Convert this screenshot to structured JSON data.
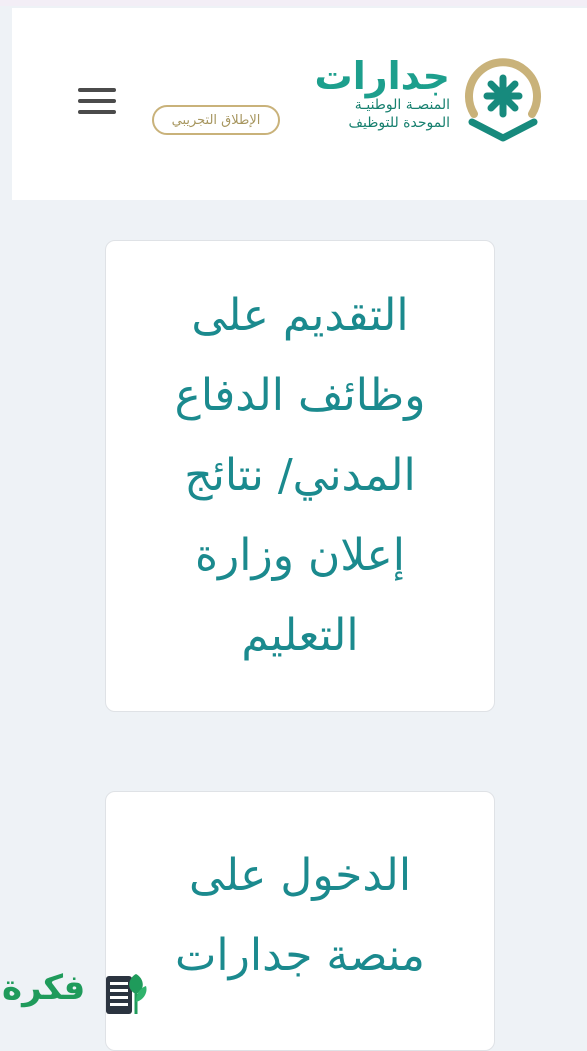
{
  "header": {
    "logo_name": "جدارات",
    "logo_sub_line1": "المنصـة الوطنيـة",
    "logo_sub_line2": "الموحدة للتوظيف",
    "beta_label": "الإطلاق التجريبي",
    "menu_icon": "hamburger-menu-icon"
  },
  "cards": [
    {
      "title": "التقديم على وظائف الدفاع المدني/ نتائج إعلان وزارة التعليم"
    },
    {
      "title": "الدخول على منصة جدارات"
    }
  ],
  "watermark": {
    "text": "فكرة",
    "icon": "book-plant-icon"
  },
  "colors": {
    "accent": "#1b8a8e",
    "logo_green": "#1d9f8d",
    "gold": "#c9b27a",
    "background": "#eef2f6"
  }
}
